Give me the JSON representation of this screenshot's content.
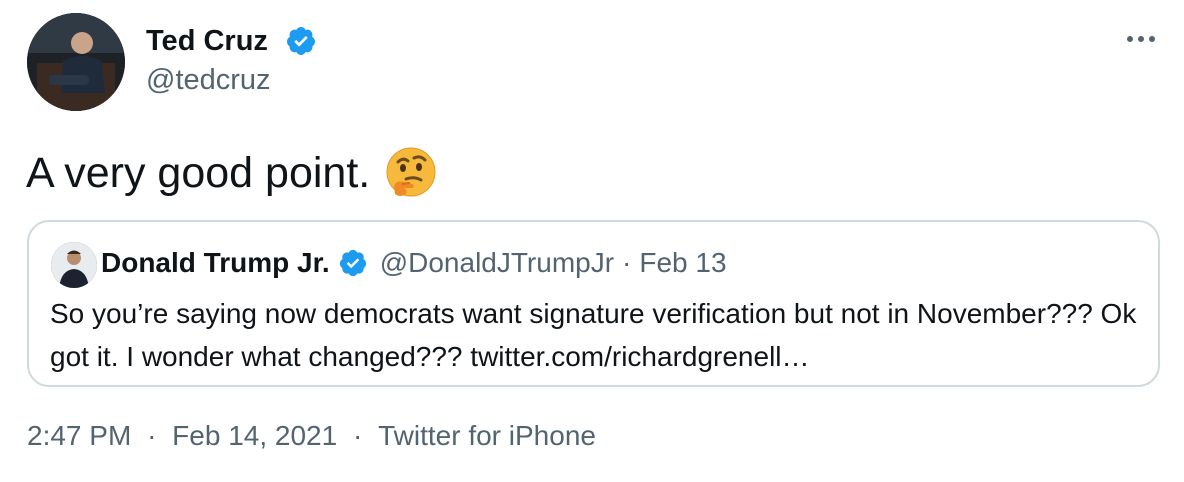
{
  "author": {
    "name": "Ted Cruz",
    "handle": "@tedcruz"
  },
  "tweet": {
    "text": "A very good point.",
    "emoji": "thinking-face"
  },
  "quoted": {
    "name": "Donald Trump Jr.",
    "handle": "@DonaldJTrumpJr",
    "separator": "·",
    "date": "Feb 13",
    "text": "So you’re saying now democrats want signature verification but not in November??? Ok got it. I wonder what changed??? twitter.com/richardgrenell…"
  },
  "footer": {
    "time": "2:47 PM",
    "sep1": "·",
    "date": "Feb 14, 2021",
    "sep2": "·",
    "source": "Twitter for iPhone"
  },
  "colors": {
    "verified": "#1d9bf0",
    "text": "#0f1419",
    "muted": "#536471",
    "border": "#cfd9de"
  }
}
